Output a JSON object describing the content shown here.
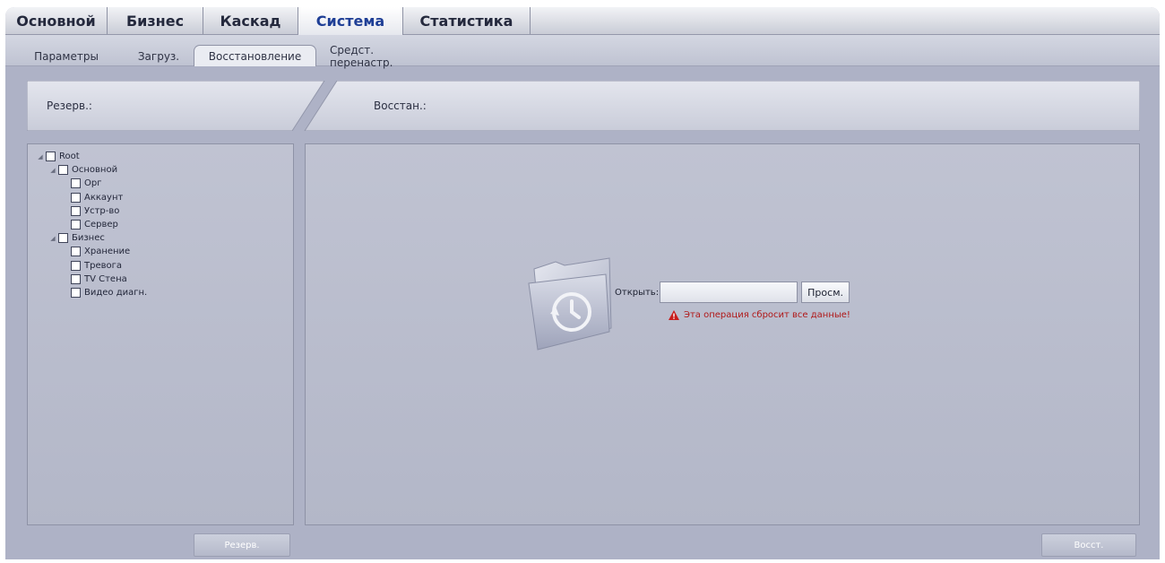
{
  "main_tabs": [
    {
      "label": "Основной",
      "active": false
    },
    {
      "label": "Бизнес",
      "active": false
    },
    {
      "label": "Каскад",
      "active": false
    },
    {
      "label": "Система",
      "active": true
    },
    {
      "label": "Статистика",
      "active": false
    }
  ],
  "sub_tabs": [
    {
      "label": "Параметры",
      "active": false
    },
    {
      "label": "Загруз.",
      "active": false
    },
    {
      "label": "Восстановление",
      "active": true
    },
    {
      "label": "Средст. перенастр.",
      "active": false
    }
  ],
  "header": {
    "backup_label": "Резерв.:",
    "restore_label": "Восстан.:"
  },
  "tree": [
    {
      "label": "Root",
      "level": 0,
      "expandable": true
    },
    {
      "label": "Основной",
      "level": 1,
      "expandable": true
    },
    {
      "label": "Орг",
      "level": 2,
      "expandable": false
    },
    {
      "label": "Аккаунт",
      "level": 2,
      "expandable": false
    },
    {
      "label": "Устр-во",
      "level": 2,
      "expandable": false
    },
    {
      "label": "Сервер",
      "level": 2,
      "expandable": false
    },
    {
      "label": "Бизнес",
      "level": 1,
      "expandable": true
    },
    {
      "label": "Хранение",
      "level": 2,
      "expandable": false
    },
    {
      "label": "Тревога",
      "level": 2,
      "expandable": false
    },
    {
      "label": "TV Стена",
      "level": 2,
      "expandable": false
    },
    {
      "label": "Видео диагн.",
      "level": 2,
      "expandable": false
    }
  ],
  "restore": {
    "open_label": "Открыть:",
    "file_value": "",
    "browse_label": "Просм.",
    "warning": "Эта операция сбросит все данные!"
  },
  "buttons": {
    "backup": "Резерв.",
    "restore": "Восст."
  },
  "colors": {
    "background": "#aeb2c6",
    "active_main_tab_text": "#1f3f96",
    "warning": "#b01818"
  },
  "icons": {
    "folder": "restore-folder-icon",
    "warning": "warning-triangle-icon",
    "expand": "expand-arrow-icon"
  }
}
